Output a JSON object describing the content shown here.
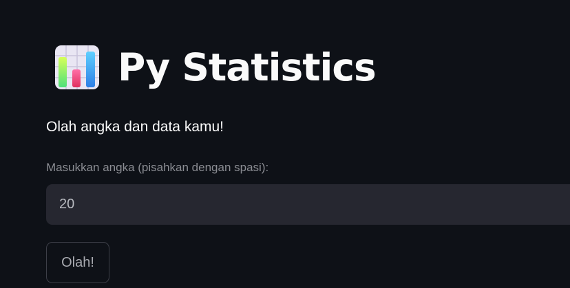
{
  "header": {
    "icon": "bar-chart-emoji-icon",
    "title": "Py Statistics"
  },
  "main": {
    "subtitle": "Olah angka dan data kamu!",
    "numbers_input": {
      "label": "Masukkan angka (pisahkan dengan spasi):",
      "value": "20"
    },
    "submit_label": "Olah!"
  },
  "colors": {
    "background": "#0e1117",
    "input_background": "#262730",
    "text": "#fafafa",
    "muted_text": "#8b8d93",
    "button_border": "#3d3f48"
  }
}
